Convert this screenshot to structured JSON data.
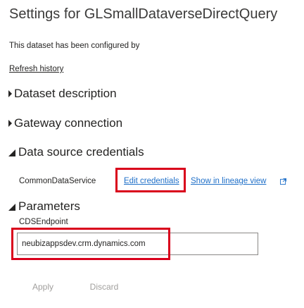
{
  "header": {
    "title": "Settings for GLSmallDataverseDirectQuery",
    "subtitle": "This dataset has been configured by",
    "refresh_history": "Refresh history"
  },
  "sections": {
    "dataset_description": "Dataset description",
    "gateway_connection": "Gateway connection",
    "data_source_credentials": "Data source credentials",
    "parameters": "Parameters"
  },
  "credentials": {
    "source_name": "CommonDataService",
    "edit_label": "Edit credentials",
    "lineage_label": "Show in lineage view",
    "external_icon": "external-link-icon"
  },
  "parameters": {
    "field_label": "CDSEndpoint",
    "field_value": "neubizappsdev.crm.dynamics.com"
  },
  "actions": {
    "apply": "Apply",
    "discard": "Discard"
  },
  "colors": {
    "link": "#1e6fc8",
    "highlight": "#d9001b",
    "disabled_text": "#a19f9d"
  }
}
